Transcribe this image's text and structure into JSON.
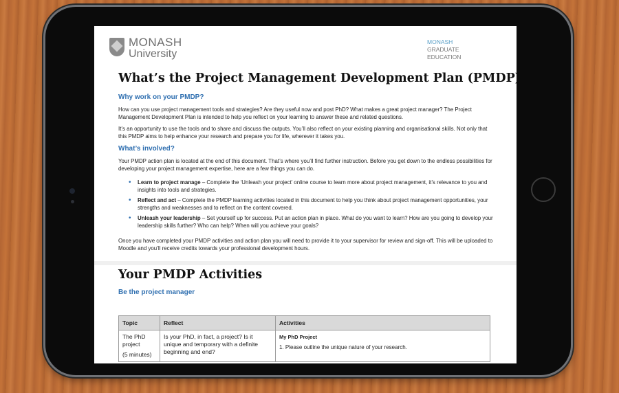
{
  "logo": {
    "line1": "MONASH",
    "line2": "University"
  },
  "grad_logo": {
    "line1": "MONASH",
    "line2": "GRADUATE",
    "line3": "EDUCATION"
  },
  "title": "What’s the Project Management Development Plan (PMDP)?",
  "why": {
    "heading": "Why work on your PMDP?",
    "p1": "How can you use project management tools and strategies? Are they useful now and post PhD? What makes a great project manager? The Project Management Development Plan is intended to help you reflect on your learning to answer these and related questions.",
    "p2": "It’s an opportunity to use the tools and to share and discuss the outputs. You’ll also reflect on your existing planning and organisational skills. Not only that this PMDP aims to help enhance your research and prepare you for life, wherever it takes you."
  },
  "involved": {
    "heading": "What’s involved?",
    "p1": "Your PMDP action plan is located at the end of this document. That’s where you’ll find further instruction. Before you get down to the endless possibilities for developing your project management expertise, here are a few things you can do.",
    "bullets": [
      {
        "bold": "Learn to project manage",
        "text": " – Complete the ‘Unleash your project’ online course to learn more about project management, it’s relevance to you and insights into tools and strategies."
      },
      {
        "bold": "Reflect and act",
        "text": " – Complete the PMDP learning activities located in this document to help you think about project management opportunities, your strengths and weaknesses and to reflect on the content covered."
      },
      {
        "bold": "Unleash your leadership",
        "text": " – Set yourself up for success. Put an action plan in place. What do you want to learn? How are you going to develop your leadership skills further? Who can help? When will you achieve your goals?"
      }
    ],
    "p2": "Once you have completed your PMDP activities and action plan you will need to provide it to your supervisor for review and sign-off. This will be uploaded to Moodle and you’ll receive credits towards your professional development hours."
  },
  "activities": {
    "title": "Your PMDP Activities",
    "subheading": "Be the project manager",
    "columns": [
      "Topic",
      "Reflect",
      "Activities"
    ],
    "row": {
      "topic": "The PhD project",
      "duration": "(5 minutes)",
      "reflect": "Is your PhD, in fact, a project? Is it unique and temporary with a definite beginning and end?",
      "activity_title": "My PhD Project",
      "activity_item": "1.   Please outline the unique nature of your research."
    }
  }
}
